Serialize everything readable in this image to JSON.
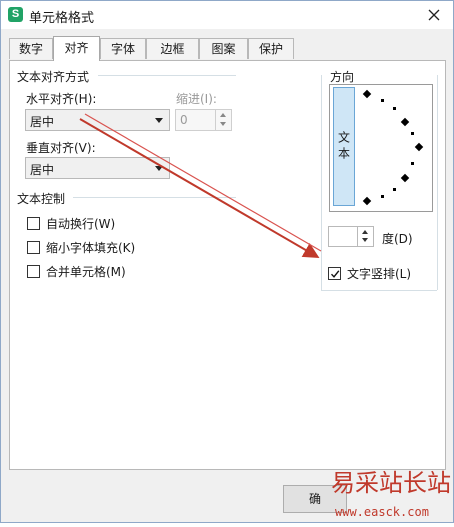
{
  "dialog": {
    "title": "单元格格式",
    "app_icon": "S",
    "close_icon": "close-icon"
  },
  "tabs": [
    {
      "label": "数字",
      "active": false
    },
    {
      "label": "对齐",
      "active": true
    },
    {
      "label": "字体",
      "active": false
    },
    {
      "label": "边框",
      "active": false
    },
    {
      "label": "图案",
      "active": false
    },
    {
      "label": "保护",
      "active": false
    }
  ],
  "alignment": {
    "group_title": "文本对齐方式",
    "horizontal_label": "水平对齐(H):",
    "horizontal_value": "居中",
    "indent_label": "缩进(I):",
    "indent_value": "0",
    "vertical_label": "垂直对齐(V):",
    "vertical_value": "居中"
  },
  "text_control": {
    "group_title": "文本控制",
    "wrap_text": {
      "label": "自动换行(W)",
      "checked": false
    },
    "shrink_to_fit": {
      "label": "缩小字体填充(K)",
      "checked": false
    },
    "merge_cells": {
      "label": "合并单元格(M)",
      "checked": false
    }
  },
  "orientation": {
    "group_title": "方向",
    "vertical_text_button": "文本",
    "degree_label": "度(D)",
    "degree_value": "",
    "vertical_text_checkbox": {
      "label": "文字竖排(L)",
      "checked": true
    }
  },
  "footer": {
    "ok_label": "确"
  },
  "watermark": {
    "cn": "易采站长站",
    "url": "www.easck.com"
  },
  "colors": {
    "annotation_arrow": "#c0392b",
    "vertical_button_fill": "#cfe6f6",
    "app_icon": "#21a366"
  }
}
